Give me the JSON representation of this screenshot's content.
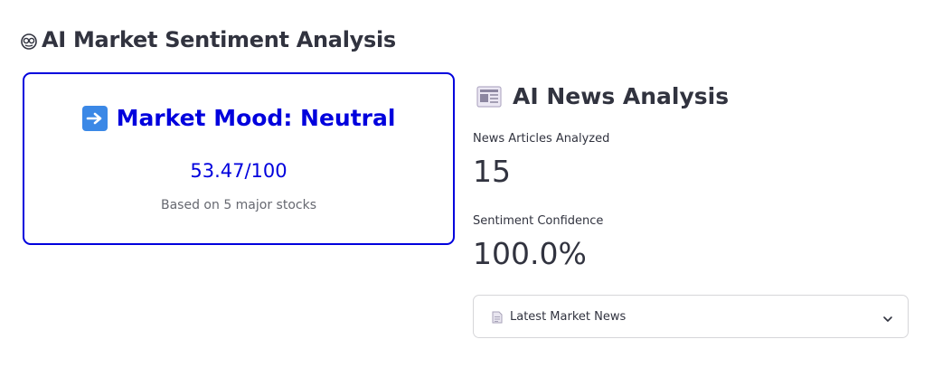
{
  "page": {
    "title": "AI Market Sentiment Analysis",
    "title_icon": "brain-icon"
  },
  "mood_card": {
    "icon": "right-arrow-icon",
    "heading": "Market Mood: Neutral",
    "score": "53.47/100",
    "basis": "Based on 5 major stocks",
    "accent_color": "#0000dd"
  },
  "news_section": {
    "icon": "newspaper-icon",
    "title": "AI News Analysis",
    "metrics": [
      {
        "label": "News Articles Analyzed",
        "value": "15"
      },
      {
        "label": "Sentiment Confidence",
        "value": "100.0%"
      }
    ],
    "expander": {
      "icon": "document-icon",
      "label": "Latest Market News",
      "expanded": false
    }
  }
}
